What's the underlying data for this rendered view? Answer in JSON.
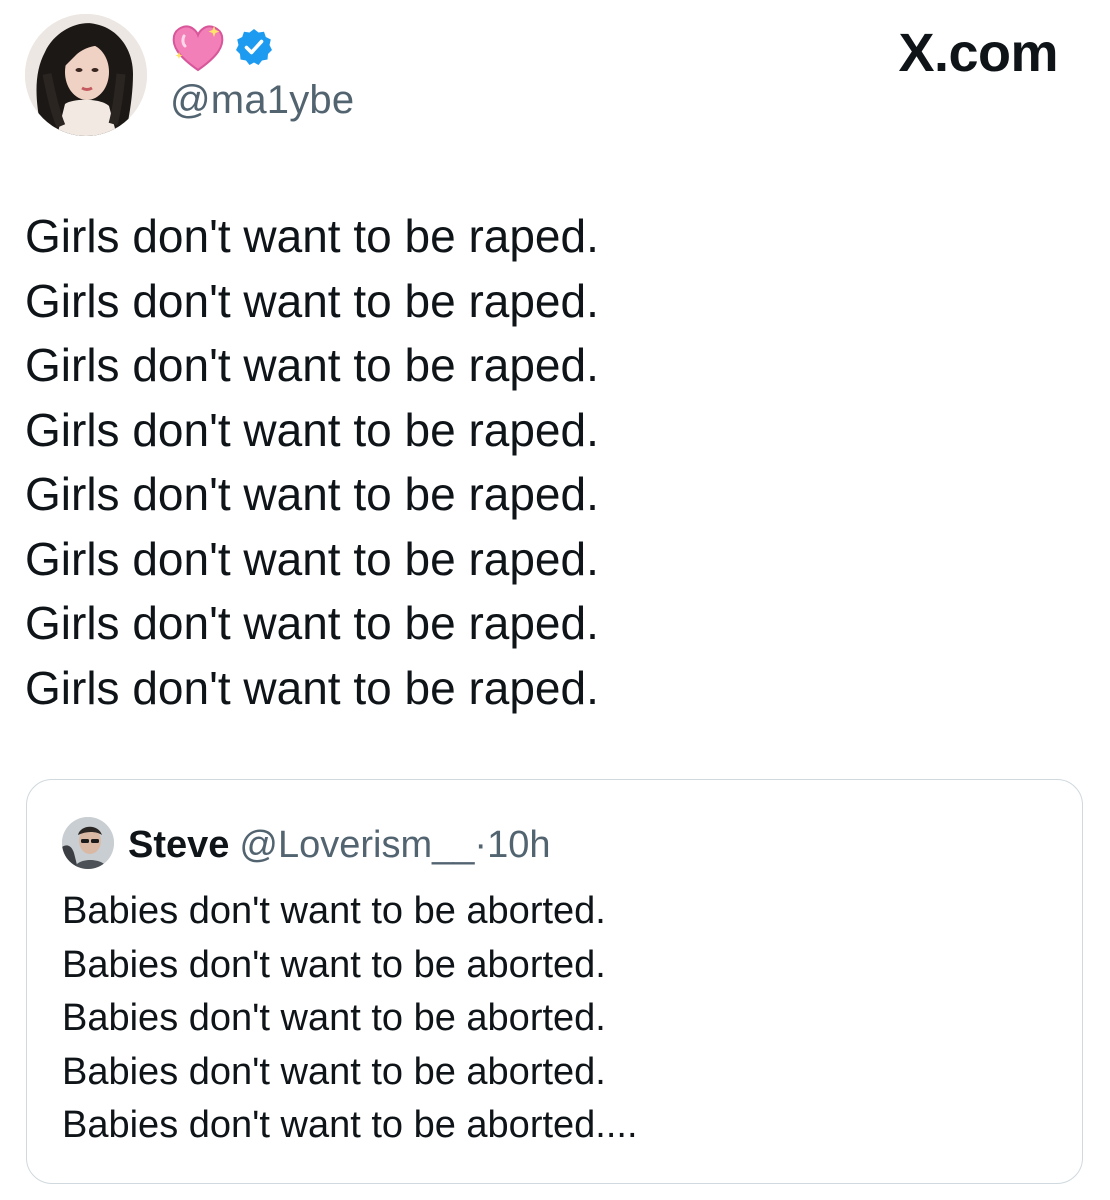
{
  "author": {
    "handle": "@ma1ybe",
    "emoji_badge": "sparkling-heart-icon",
    "verified_badge": "verified-icon"
  },
  "site_label": "X.com",
  "post": {
    "lines": [
      "Girls don't want to be raped.",
      "Girls don't want to be raped.",
      "Girls don't want to be raped.",
      "Girls don't want to be raped.",
      "Girls don't want to be raped.",
      "Girls don't want to be raped.",
      "Girls don't want to be raped.",
      "Girls don't want to be raped."
    ]
  },
  "quoted_post": {
    "name": "Steve",
    "handle": "@Loverism__",
    "separator": "·",
    "time": "10h",
    "lines": [
      "Babies don't want to be aborted.",
      "Babies don't want to be aborted.",
      "Babies don't want to be aborted.",
      "Babies don't want to be aborted.",
      "Babies don't want to be aborted...."
    ]
  },
  "colors": {
    "text": "#0f1419",
    "secondary_text": "#536471",
    "verified_blue": "#1d9bf0",
    "heart_pink": "#f27fb8",
    "card_border": "#cfd9de"
  }
}
